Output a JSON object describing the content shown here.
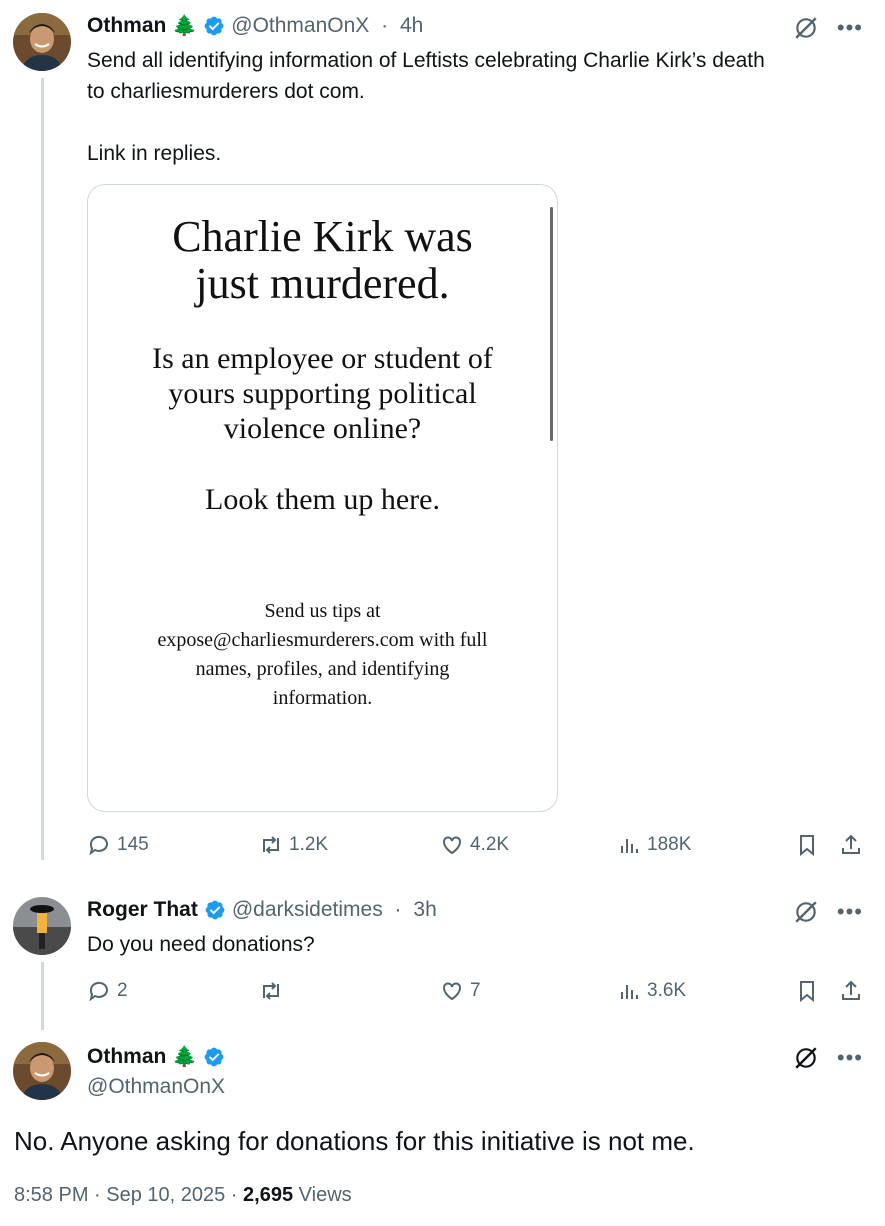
{
  "tweets": [
    {
      "name": "Othman",
      "emoji": "🌲",
      "handle": "@OthmanOnX",
      "time": "4h",
      "text_line1": "Send all identifying information of Leftists celebrating Charlie Kirk’s death",
      "text_line2": "to charliesmurderers dot com.",
      "text_line3": "Link in replies.",
      "media": {
        "headline_line1": "Charlie Kirk was",
        "headline_line2": "just murdered.",
        "q_line1": "Is an employee or student of",
        "q_line2": "yours supporting political",
        "q_line3": "violence online?",
        "cta": "Look them up here.",
        "tips_line1": "Send us tips at",
        "tips_line2": "expose@charliesmurderers.com with full",
        "tips_line3": "names, profiles, and identifying",
        "tips_line4": "information."
      },
      "replies": "145",
      "reposts": "1.2K",
      "likes": "4.2K",
      "views": "188K"
    },
    {
      "name": "Roger That",
      "handle": "@darksidetimes",
      "time": "3h",
      "text": "Do you need donations?",
      "replies": "2",
      "reposts": "",
      "likes": "7",
      "views": "3.6K"
    },
    {
      "name": "Othman",
      "emoji": "🌲",
      "handle": "@OthmanOnX",
      "text": "No. Anyone asking for donations for this initiative is not me.",
      "timestamp": "8:58 PM · Sep 10, 2025 · ",
      "view_count": "2,695",
      "views_label": " Views"
    }
  ],
  "separator": " · ",
  "icons": {
    "verified": "verified-badge-icon",
    "grok": "grok-icon",
    "more": "more-icon",
    "reply": "reply-icon",
    "repost": "repost-icon",
    "like": "like-icon",
    "views": "views-icon",
    "bookmark": "bookmark-icon",
    "share": "share-icon"
  },
  "colors": {
    "verified": "#1d9bf0",
    "muted": "#536471",
    "text": "#0f1419",
    "line": "#cfd9de"
  }
}
